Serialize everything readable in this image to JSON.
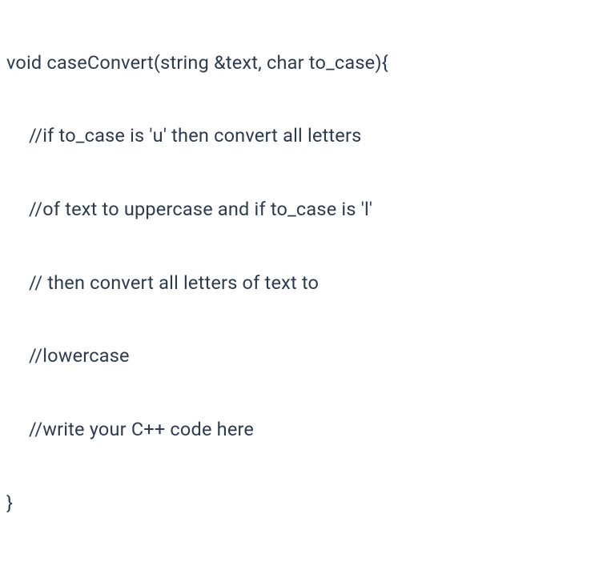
{
  "code": {
    "line1": "void caseConvert(string &text, char to_case){",
    "line2": "//if to_case is 'u' then convert all letters",
    "line3": "//of text to uppercase and if to_case is 'l'",
    "line4": "// then convert all letters of text to",
    "line5": "//lowercase",
    "line6": "//write your C++ code here",
    "line7": "}"
  }
}
